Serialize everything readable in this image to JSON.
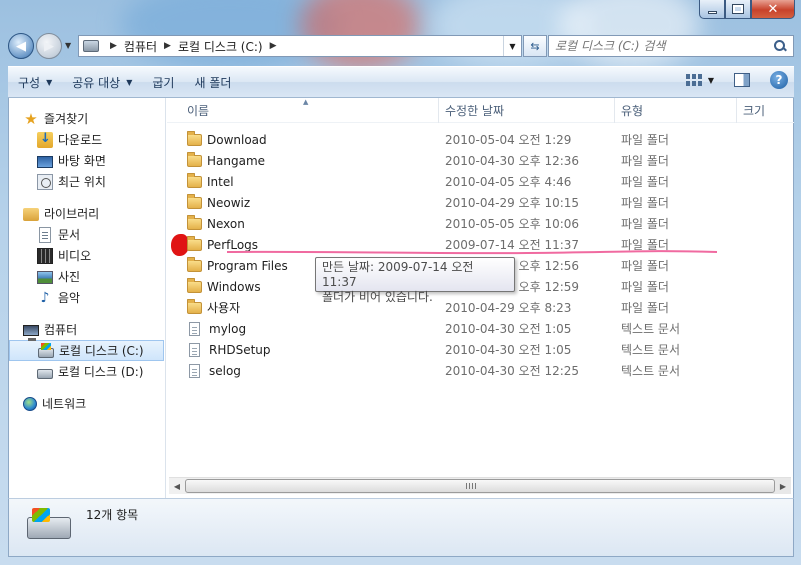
{
  "address": {
    "segments": [
      "컴퓨터",
      "로컬 디스크 (C:)"
    ]
  },
  "search": {
    "placeholder": "로컬 디스크 (C:) 검색"
  },
  "toolbar": {
    "organize": "구성",
    "share": "공유 대상",
    "burn": "굽기",
    "new_folder": "새 폴더"
  },
  "nav": {
    "favorites": "즐겨찾기",
    "downloads": "다운로드",
    "desktop": "바탕 화면",
    "recent": "최근 위치",
    "libraries": "라이브러리",
    "documents": "문서",
    "videos": "비디오",
    "pictures": "사진",
    "music": "음악",
    "computer": "컴퓨터",
    "drive_c": "로컬 디스크 (C:)",
    "drive_d": "로컬 디스크 (D:)",
    "network": "네트워크"
  },
  "columns": {
    "name": "이름",
    "modified": "수정한 날짜",
    "type": "유형",
    "size": "크기"
  },
  "files": [
    {
      "name": "Download",
      "date": "2010-05-04 오전 1:29",
      "type": "파일 폴더",
      "kind": "folder"
    },
    {
      "name": "Hangame",
      "date": "2010-04-30 오후 12:36",
      "type": "파일 폴더",
      "kind": "folder"
    },
    {
      "name": "Intel",
      "date": "2010-04-05 오후 4:46",
      "type": "파일 폴더",
      "kind": "folder"
    },
    {
      "name": "Neowiz",
      "date": "2010-04-29 오후 10:15",
      "type": "파일 폴더",
      "kind": "folder"
    },
    {
      "name": "Nexon",
      "date": "2010-05-05 오후 10:06",
      "type": "파일 폴더",
      "kind": "folder"
    },
    {
      "name": "PerfLogs",
      "date": "2009-07-14 오전 11:37",
      "type": "파일 폴더",
      "kind": "folder"
    },
    {
      "name": "Program Files",
      "date": "2010-04-30 오후 12:56",
      "type": "파일 폴더",
      "kind": "folder"
    },
    {
      "name": "Windows",
      "date": "2010-04-30 오후 12:59",
      "type": "파일 폴더",
      "kind": "folder"
    },
    {
      "name": "사용자",
      "date": "2010-04-29 오후 8:23",
      "type": "파일 폴더",
      "kind": "folder"
    },
    {
      "name": "mylog",
      "date": "2010-04-30 오전 1:05",
      "type": "텍스트 문서",
      "kind": "file"
    },
    {
      "name": "RHDSetup",
      "date": "2010-04-30 오전 1:05",
      "type": "텍스트 문서",
      "kind": "file"
    },
    {
      "name": "selog",
      "date": "2010-04-30 오전 12:25",
      "type": "텍스트 문서",
      "kind": "file"
    }
  ],
  "tooltip": {
    "line1": "만든 날짜: 2009-07-14 오전 11:37",
    "line2": "폴더가 비어 있습니다."
  },
  "status": {
    "count": "12개 항목"
  }
}
